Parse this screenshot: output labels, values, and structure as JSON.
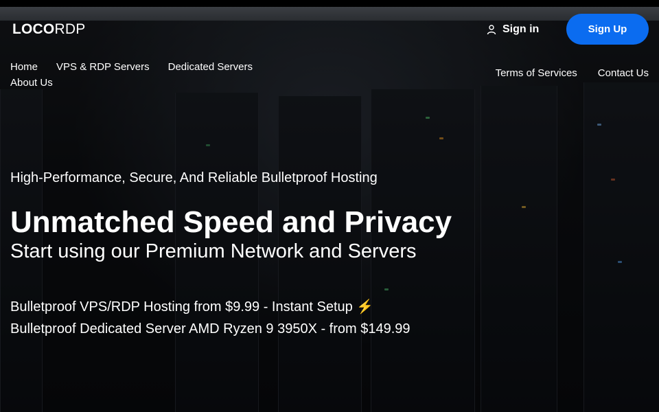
{
  "brand": {
    "logo_bold": "LOCO",
    "logo_light": "RDP"
  },
  "header": {
    "signin_label": "Sign in",
    "signup_label": "Sign Up",
    "signup_color": "#0b6cf0"
  },
  "nav": {
    "left": [
      "Home",
      "VPS & RDP Servers",
      "Dedicated Servers",
      "About Us"
    ],
    "right": [
      "Terms of Services",
      "Contact Us"
    ]
  },
  "hero": {
    "tagline": "High-Performance, Secure, And Reliable Bulletproof Hosting",
    "headline": "Unmatched Speed and Privacy",
    "subheadline": "Start using our Premium Network and Servers",
    "offers": [
      "Bulletproof VPS/RDP Hosting from $9.99 - Instant Setup ⚡",
      "Bulletproof Dedicated Server AMD Ryzen 9 3950X - from $149.99"
    ]
  },
  "icons": {
    "signin": "user-icon"
  }
}
